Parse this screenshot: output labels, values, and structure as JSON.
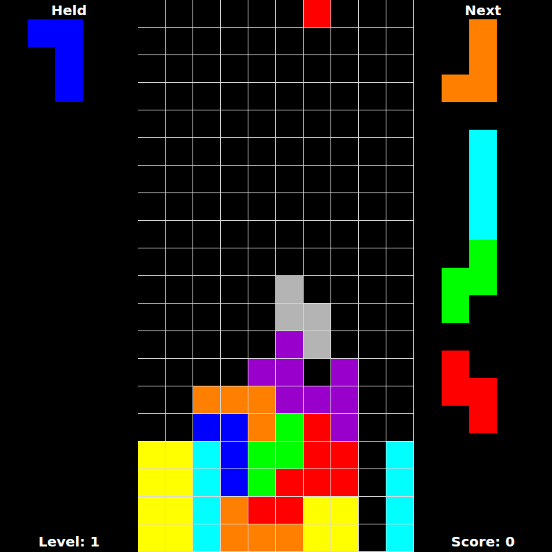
{
  "held": {
    "title": "Held",
    "piece": {
      "color": "#0000ff",
      "shape": [
        "XX",
        ".X",
        ".X"
      ]
    }
  },
  "next": {
    "title": "Next",
    "pieces": [
      {
        "color": "#ff7f00",
        "shape": [
          ".X",
          ".X",
          "XX"
        ]
      },
      {
        "color": "#00ffff",
        "shape": [
          ".X",
          ".X",
          ".X",
          ".X"
        ]
      },
      {
        "color": "#00ff00",
        "shape": [
          ".X",
          "XX",
          "X."
        ]
      },
      {
        "color": "#ff0000",
        "shape": [
          "X.",
          "XX",
          ".X"
        ]
      }
    ]
  },
  "board": {
    "palette": {
      "Y": "#ffff00",
      "C": "#00ffff",
      "B": "#0000ff",
      "O": "#ff7f00",
      "G": "#00ff00",
      "R": "#ff0000",
      "P": "#9900cc",
      "S": "#b4b4b4"
    },
    "rows": [
      "......R...",
      "..........",
      "..........",
      "..........",
      "..........",
      "..........",
      "..........",
      "..........",
      "..........",
      "..........",
      ".....S....",
      ".....SS...",
      ".....PS...",
      "....PP.P..",
      "..OOOPPP..",
      "..BBOGRP..",
      "YYCBGGRR.C",
      "YYCBGRRR.C",
      "YYCORRYY.C",
      "YYCOOOYY.C"
    ]
  },
  "level": {
    "label": "Level: 1"
  },
  "score": {
    "label": "Score: 0"
  }
}
